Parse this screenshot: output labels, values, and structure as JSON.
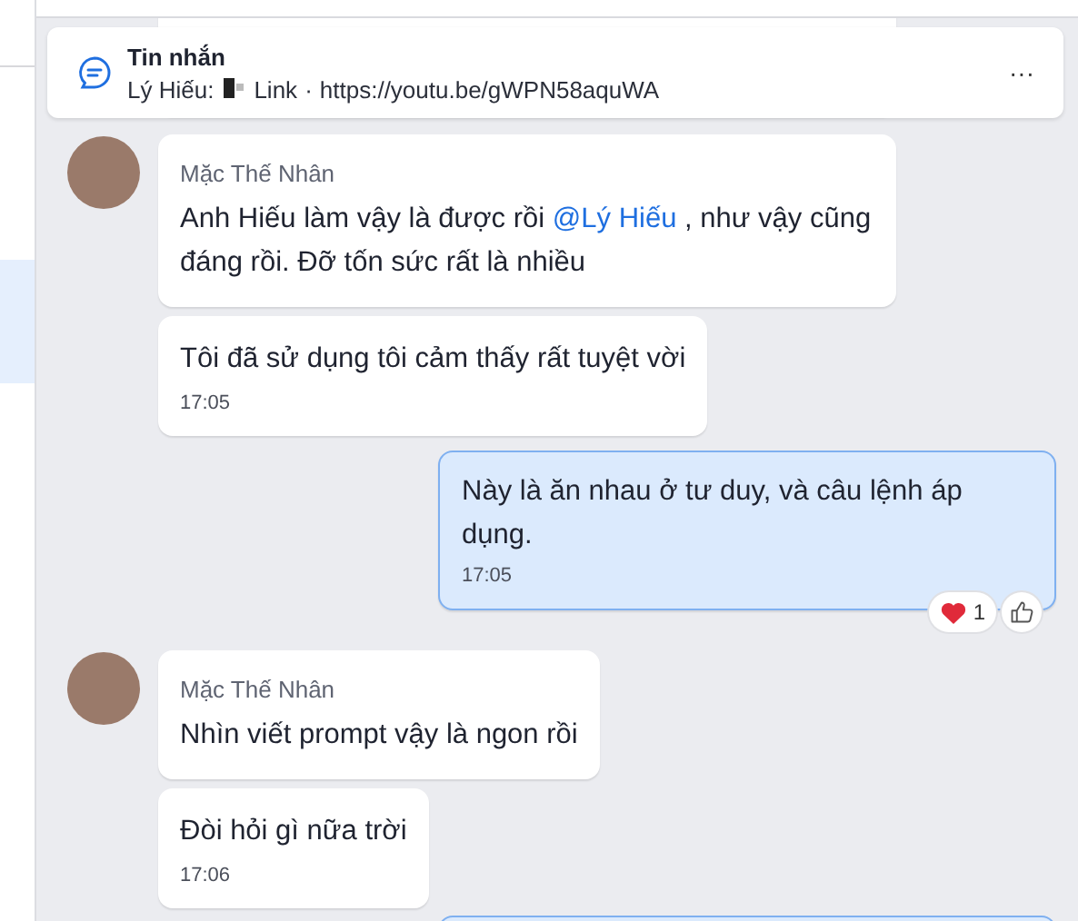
{
  "pinned": {
    "title": "Tin nhắn",
    "sender": "Lý Hiếu:",
    "type_label": "Link",
    "separator": "·",
    "url": "https://youtu.be/gWPN58aquWA",
    "more": "···"
  },
  "messages": [
    {
      "kind": "incoming",
      "sender": "Mặc Thế Nhân",
      "bubbles": [
        {
          "parts": [
            {
              "text": "Anh Hiếu làm vậy là được rồi "
            },
            {
              "text": "@Lý Hiếu",
              "kind": "mention"
            },
            {
              "text": " , như vậy cũng đáng rồi.  Đỡ tốn sức rất là nhiều"
            }
          ]
        },
        {
          "parts": [
            {
              "text": "Tôi đã sử dụng tôi cảm thấy rất tuyệt vời"
            }
          ],
          "time": "17:05"
        }
      ]
    },
    {
      "kind": "outgoing",
      "bubbles": [
        {
          "parts": [
            {
              "text": "Này là ăn nhau ở tư duy, và câu lệnh áp dụng."
            }
          ],
          "time": "17:05",
          "reactions": {
            "heart_count": "1"
          }
        }
      ]
    },
    {
      "kind": "incoming",
      "sender": "Mặc Thế Nhân",
      "bubbles": [
        {
          "parts": [
            {
              "text": "Nhìn viết prompt vậy là ngon rồi"
            }
          ]
        },
        {
          "parts": [
            {
              "text": "Đòi hỏi gì nữa trời"
            }
          ],
          "time": "17:06"
        }
      ]
    }
  ]
}
